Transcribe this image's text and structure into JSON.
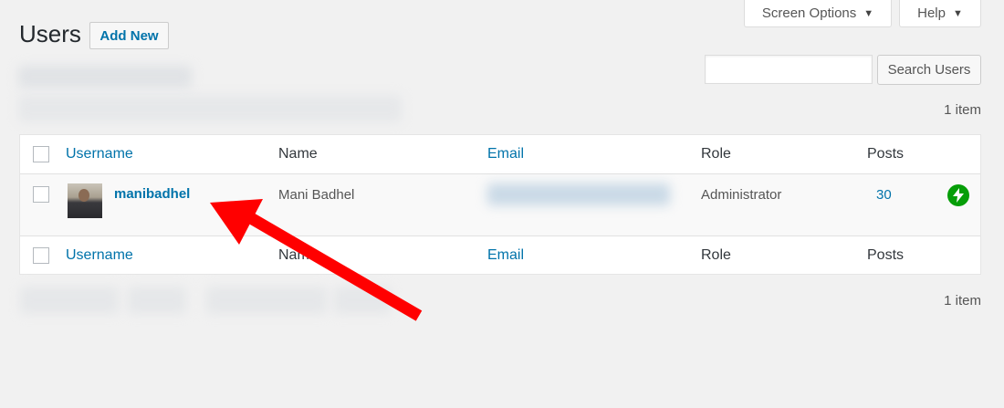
{
  "header": {
    "screen_options": "Screen Options",
    "help": "Help",
    "title": "Users",
    "add_new": "Add New"
  },
  "search": {
    "button": "Search Users",
    "value": ""
  },
  "pagination": {
    "top_count": "1 item",
    "bottom_count": "1 item"
  },
  "table": {
    "columns": {
      "username": "Username",
      "name": "Name",
      "email": "Email",
      "role": "Role",
      "posts": "Posts"
    },
    "rows": [
      {
        "username": "manibadhel",
        "name": "Mani Badhel",
        "role": "Administrator",
        "posts": "30"
      }
    ]
  },
  "icons": {
    "jetpack": "jetpack-bolt-icon",
    "caret": "caret-down-icon"
  },
  "colors": {
    "link": "#0073aa",
    "annotation_arrow": "#ff0000",
    "jetpack": "#069e08"
  }
}
